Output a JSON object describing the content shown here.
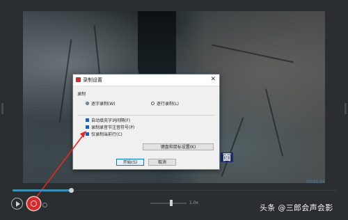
{
  "dialog": {
    "title": "录制设置",
    "close": "✕",
    "group_label": "录制",
    "mode_word": "逐字录制(W)",
    "mode_line": "逐行录制(L)",
    "opt_auto_capture": "自动填充字词间隔(F)",
    "opt_note_symbol": "录制录音节注音符号(P)",
    "opt_current_line": "仅录制当前行(C)",
    "keyboard_button": "键盘和鼠标设置(K)",
    "start_button": "开始(S)",
    "cancel_button": "取消"
  },
  "video": {
    "subtitle_char": "面",
    "timecode": "00:01:04"
  },
  "controls": {
    "speed_label": "1.0x",
    "scrub_progress": 0.2
  },
  "watermark": "头条 @三郎会声会影",
  "colors": {
    "accent": "#1a5fb4",
    "record": "#d42a2a",
    "arrow": "#e8261f"
  }
}
